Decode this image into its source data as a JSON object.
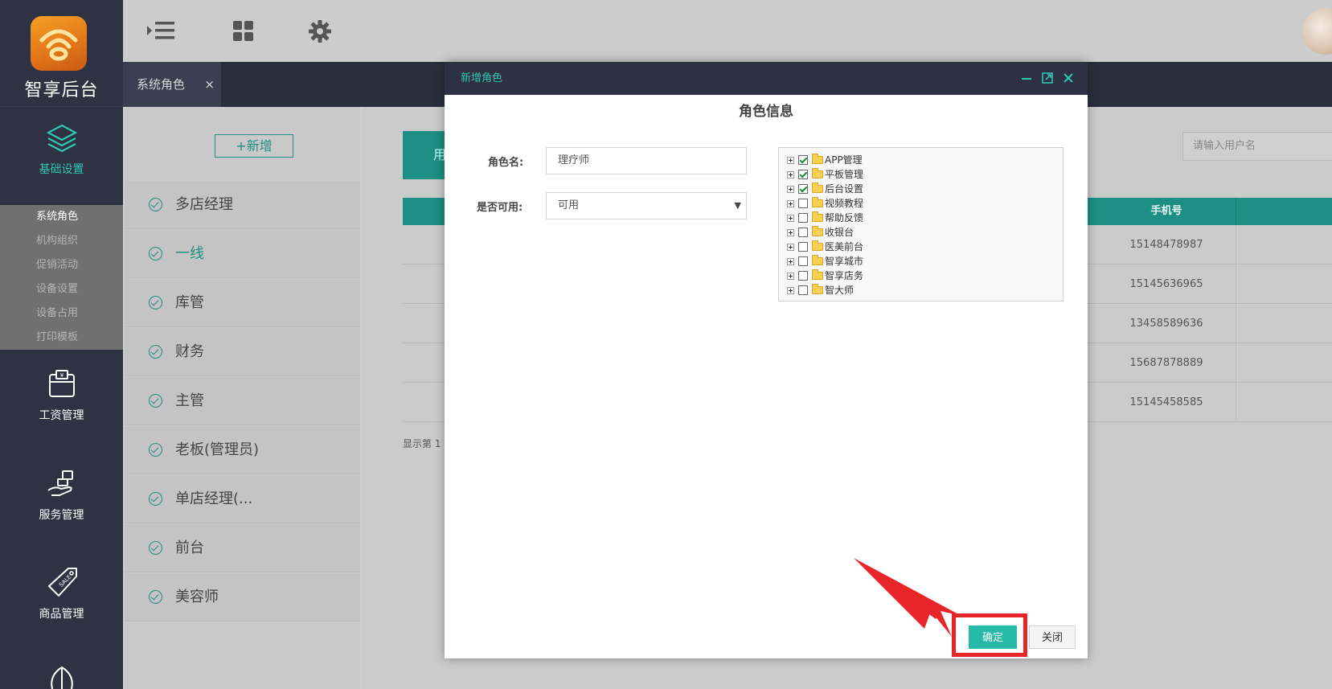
{
  "app": {
    "logo_text": "智享后台"
  },
  "rail": {
    "items": [
      {
        "label": "基础设置",
        "icon": "layers-icon"
      },
      {
        "label": "工资管理",
        "icon": "wallet-icon"
      },
      {
        "label": "服务管理",
        "icon": "hand-service-icon"
      },
      {
        "label": "商品管理",
        "icon": "sale-tag-icon"
      }
    ],
    "subitems": [
      "系统角色",
      "机构组织",
      "促销活动",
      "设备设置",
      "设备占用",
      "打印模板"
    ]
  },
  "tabs": [
    {
      "label": "系统角色",
      "close": "×"
    }
  ],
  "roles": {
    "add_label": "+新增",
    "items": [
      "多店经理",
      "一线",
      "库管",
      "财务",
      "主管",
      "老板(管理员)",
      "单店经理(...",
      "前台",
      "美容师"
    ]
  },
  "content": {
    "tab_label": "用",
    "search_placeholder": "请输入用户名",
    "column_phone": "手机号",
    "phones": [
      "15148478987",
      "15145636965",
      "13458589636",
      "15687878889",
      "15145458585"
    ],
    "pager_text": "显示第 1"
  },
  "modal": {
    "title": "新增角色",
    "section": "角色信息",
    "role_name_label": "角色名:",
    "role_name_value": "理疗师",
    "enabled_label": "是否可用:",
    "enabled_value": "可用",
    "tree": [
      {
        "label": "APP管理",
        "checked": true
      },
      {
        "label": "平板管理",
        "checked": true
      },
      {
        "label": "后台设置",
        "checked": true
      },
      {
        "label": "视频教程",
        "checked": false
      },
      {
        "label": "帮助反馈",
        "checked": false
      },
      {
        "label": "收银台",
        "checked": false
      },
      {
        "label": "医美前台",
        "checked": false
      },
      {
        "label": "智享城市",
        "checked": false
      },
      {
        "label": "智享店务",
        "checked": false
      },
      {
        "label": "智大师",
        "checked": false
      }
    ],
    "ok_label": "确定",
    "close_label": "关闭"
  },
  "colors": {
    "accent": "#25b9a8",
    "rail_bg": "#2f3242",
    "highlight": "#e8262a"
  }
}
